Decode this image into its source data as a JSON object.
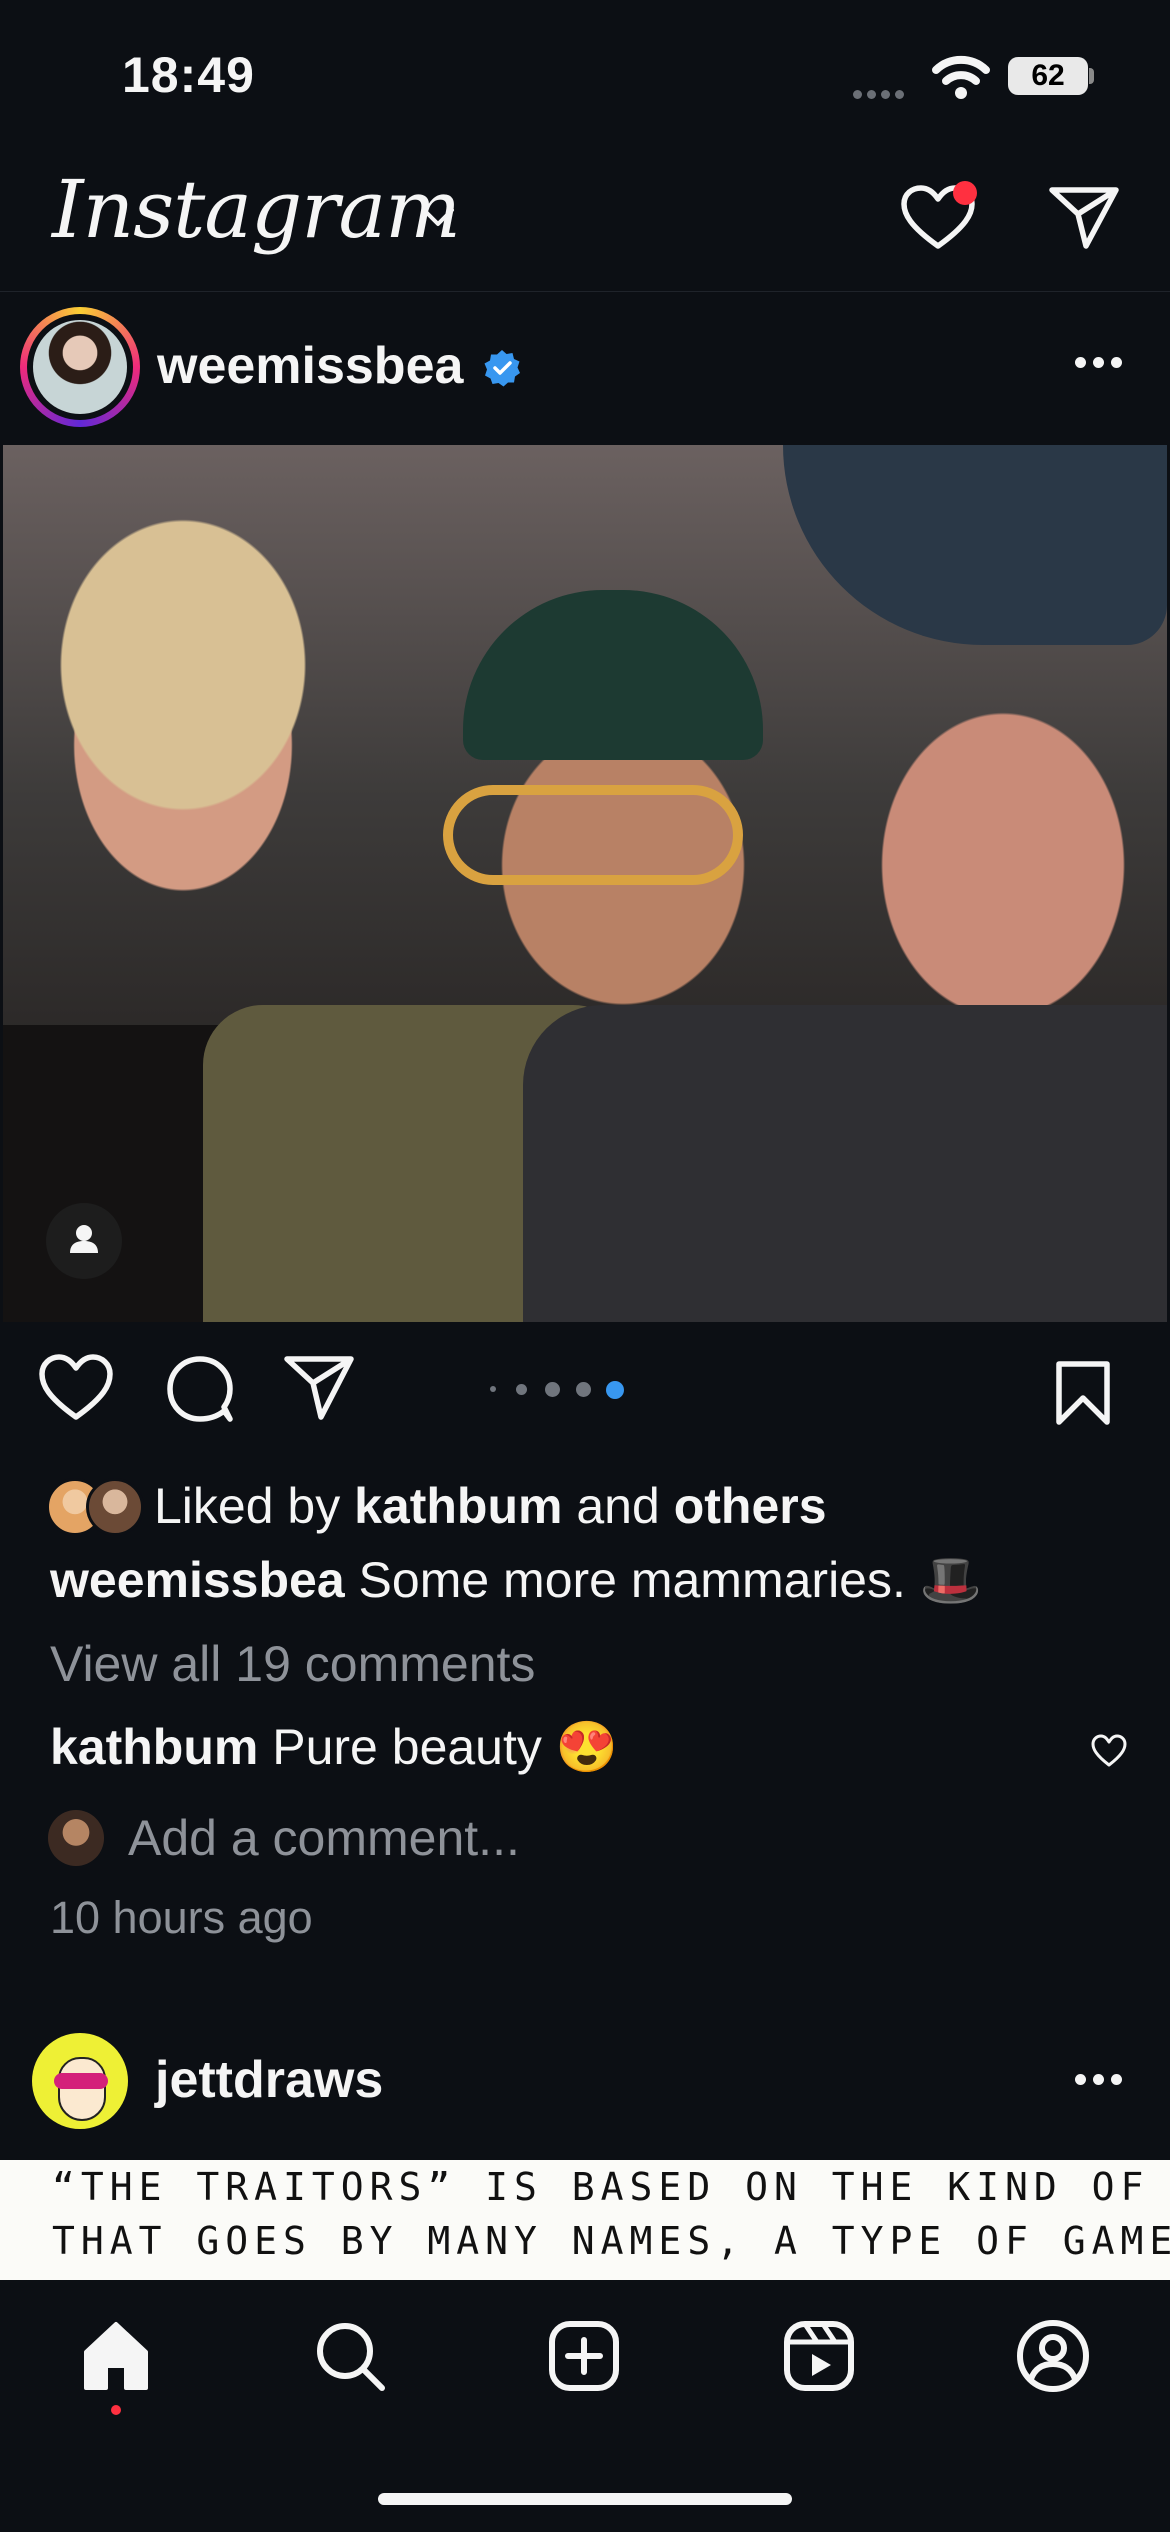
{
  "status_bar": {
    "time": "18:49",
    "battery": "62"
  },
  "header": {
    "logo": "Instagram"
  },
  "post1": {
    "username": "weemissbea",
    "carousel": {
      "total": 4,
      "active": 4
    },
    "liked_prefix": "Liked by ",
    "liked_user": "kathbum",
    "liked_mid": " and ",
    "liked_others": "others",
    "caption_user": "weemissbea",
    "caption_text": " Some more mammaries. 🎩",
    "view_comments": "View all 19 comments",
    "comment_user": "kathbum",
    "comment_text": " Pure beauty 😍",
    "add_comment_placeholder": "Add a comment...",
    "time_ago": "10 hours ago"
  },
  "post2": {
    "username": "jettdraws",
    "preview_line1": "“THE TRAITORS” IS BASED ON THE KIND OF GAME",
    "preview_line2": "THAT GOES BY MANY NAMES, A TYPE OF GAME"
  },
  "colors": {
    "background": "#0c0f14",
    "notification": "#ff3040",
    "verified": "#3897f0",
    "active_dot": "#3897f0"
  },
  "nav": {
    "items": [
      "home-icon",
      "search-icon",
      "create-icon",
      "reels-icon",
      "profile-icon"
    ],
    "active": "home-icon"
  }
}
